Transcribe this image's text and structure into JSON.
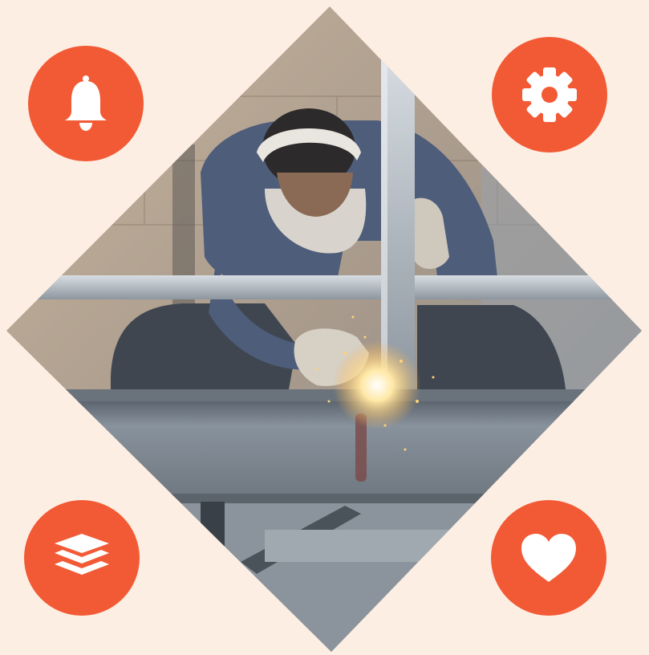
{
  "colors": {
    "background": "#fdeee3",
    "accent": "#f25a35",
    "icon_fill": "#ffffff"
  },
  "photo": {
    "subject": "welder-working-on-steel-beam",
    "shape": "diamond"
  },
  "badges": [
    {
      "icon": "bell-icon"
    },
    {
      "icon": "gear-icon"
    },
    {
      "icon": "layers-icon"
    },
    {
      "icon": "heart-icon"
    }
  ]
}
